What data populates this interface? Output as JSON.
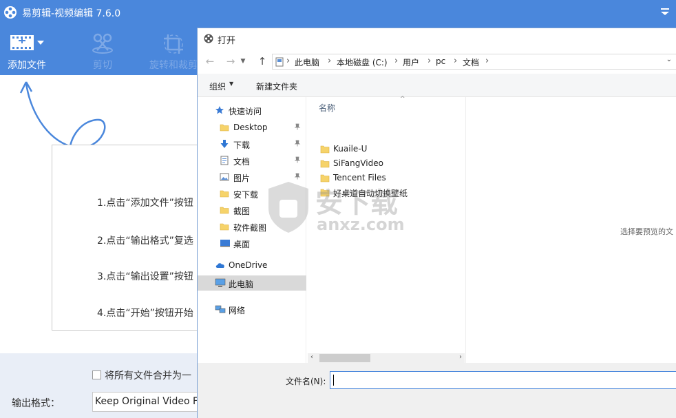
{
  "app": {
    "title": "易剪辑-视频编辑 7.6.0",
    "accent": "#4a87dc",
    "logo_icon": "film-reel-icon",
    "menu_icon": "dropdown-menu-icon"
  },
  "toolbar": {
    "add_file": "添加文件",
    "cut": "剪切",
    "rotate_crop": "旋转和裁剪"
  },
  "instructions": {
    "step1": "1.点击“添加文件”按钮",
    "step2": "2.点击“输出格式”复选",
    "step3": "3.点击“输出设置”按钮",
    "step4": "4.点击“开始”按钮开始"
  },
  "bottom": {
    "merge_label": "将所有文件合并为一",
    "merge_checked": false,
    "output_format_label": "输出格式：",
    "output_format_value": "Keep Original Video Form"
  },
  "dialog": {
    "title": "打开",
    "breadcrumb": [
      "此电脑",
      "本地磁盘 (C:)",
      "用户",
      "pc",
      "文档"
    ],
    "organize": "组织",
    "new_folder": "新建文件夹",
    "column_name": "名称",
    "nav": [
      {
        "label": "快速访问",
        "icon": "star-icon",
        "pinned": false,
        "indent": false
      },
      {
        "label": "Desktop",
        "icon": "folder-icon",
        "pinned": true,
        "indent": true
      },
      {
        "label": "下载",
        "icon": "download-icon",
        "pinned": true,
        "indent": true
      },
      {
        "label": "文档",
        "icon": "document-icon",
        "pinned": true,
        "indent": true
      },
      {
        "label": "图片",
        "icon": "picture-icon",
        "pinned": true,
        "indent": true
      },
      {
        "label": "安下载",
        "icon": "folder-icon",
        "pinned": false,
        "indent": true
      },
      {
        "label": "截图",
        "icon": "folder-icon",
        "pinned": false,
        "indent": true
      },
      {
        "label": "软件截图",
        "icon": "folder-icon",
        "pinned": false,
        "indent": true
      },
      {
        "label": "桌面",
        "icon": "desktop-icon",
        "pinned": false,
        "indent": true
      },
      {
        "label": "OneDrive",
        "icon": "cloud-icon",
        "pinned": false,
        "indent": false
      },
      {
        "label": "此电脑",
        "icon": "computer-icon",
        "pinned": false,
        "indent": false,
        "selected": true
      },
      {
        "label": "网络",
        "icon": "network-icon",
        "pinned": false,
        "indent": false
      }
    ],
    "files": [
      "Kuaile-U",
      "SiFangVideo",
      "Tencent Files",
      "好桌道自动切换壁纸"
    ],
    "preview_text": "选择要预览的文",
    "filename_label": "文件名(N):",
    "filename_value": ""
  },
  "watermark": {
    "text": "安下载",
    "url_text": "anxz.com"
  }
}
